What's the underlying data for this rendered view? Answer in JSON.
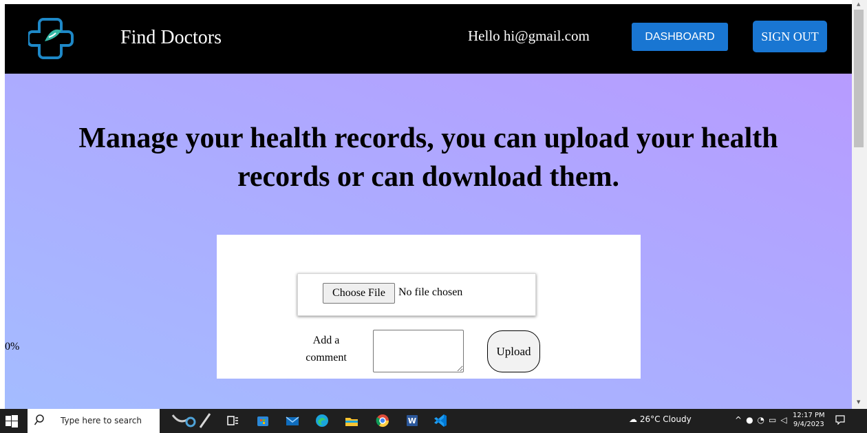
{
  "nav": {
    "brand": "Find Doctors",
    "greeting": "Hello hi@gmail.com",
    "dashboard_label": "DASHBOARD",
    "signout_label": "SIGN OUT",
    "logo_icon": "medical-cross-logo-icon"
  },
  "main": {
    "headline_line1": "Manage your health records, you can upload your health",
    "headline_line2": "records or can download them.",
    "progress": "0%",
    "choose_file_label": "Choose File",
    "file_status": "No file chosen",
    "comment_label": "Add a comment",
    "comment_value": "",
    "upload_label": "Upload"
  },
  "taskbar": {
    "search_placeholder": "Type here to search",
    "weather": "26°C  Cloudy",
    "time": "12:17 PM",
    "date": "9/4/2023",
    "icons": [
      "windows-start-icon",
      "search-icon",
      "doctor-tools-icon",
      "task-view-icon",
      "store-icon",
      "mail-icon",
      "edge-icon",
      "file-explorer-icon",
      "chrome-icon",
      "word-icon",
      "vscode-icon",
      "weather-icon",
      "notification-icon"
    ]
  },
  "colors": {
    "navbar_bg": "#000000",
    "button_blue": "#1976d2",
    "gradient_top": "#b79bff",
    "gradient_bottom": "#a4bcff",
    "taskbar_bg": "#1f1f1f"
  }
}
